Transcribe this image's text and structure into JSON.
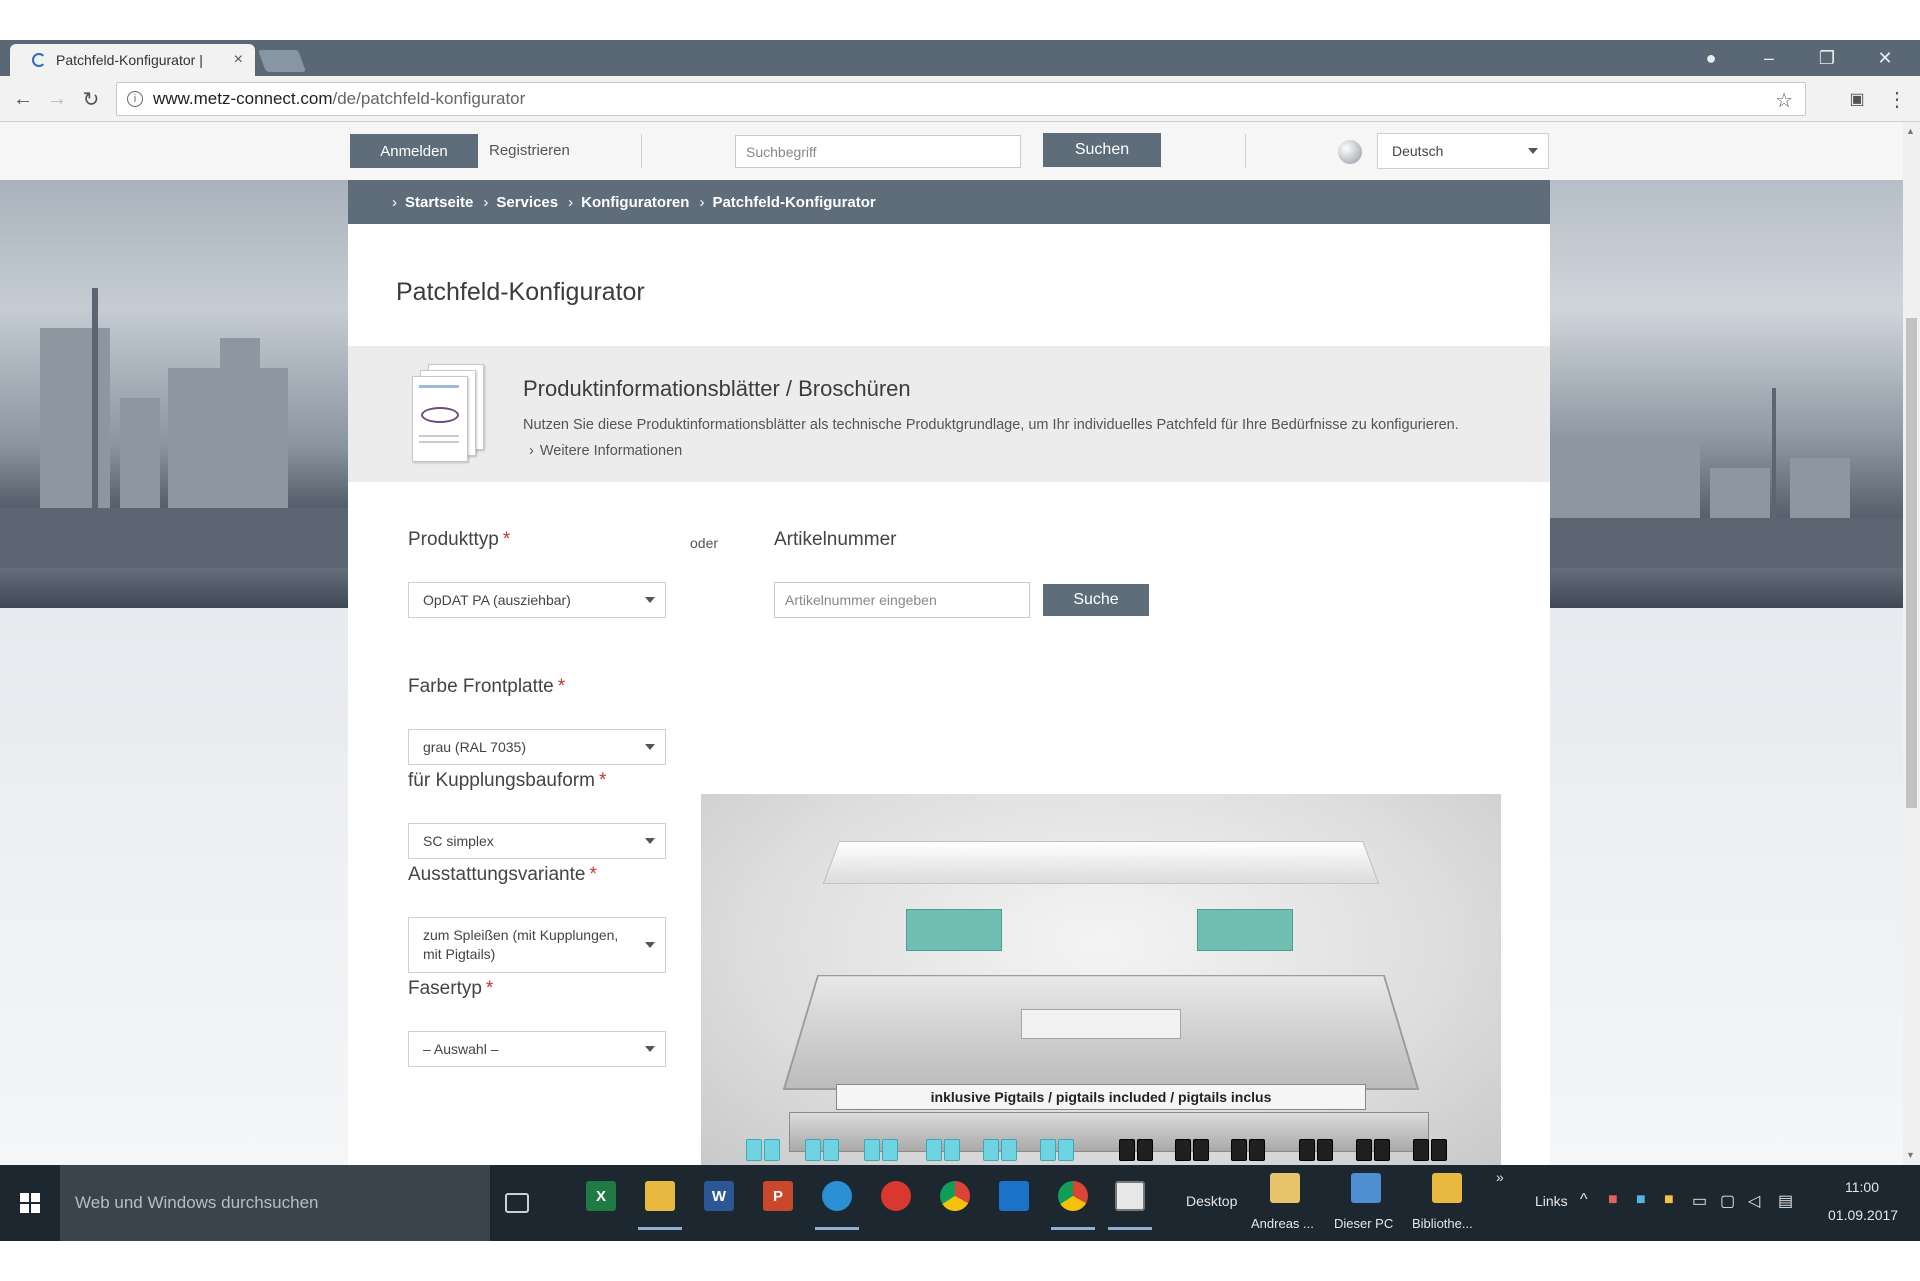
{
  "browser": {
    "tab_title": "Patchfeld-Konfigurator |",
    "tab_close": "×",
    "url_domain": "www.metz-connect.com",
    "url_path": "/de/patchfeld-konfigurator",
    "icons": [
      "back-arrow-icon",
      "forward-arrow-icon",
      "reload-icon",
      "info-icon",
      "star-icon",
      "extension-icon",
      "menu-icon",
      "profile-icon",
      "minimize-icon",
      "restore-icon",
      "close-icon"
    ]
  },
  "utility": {
    "login": "Anmelden",
    "register": "Registrieren",
    "search_placeholder": "Suchbegriff",
    "search_button": "Suchen",
    "language": "Deutsch"
  },
  "breadcrumb": [
    "Startseite",
    "Services",
    "Konfiguratoren",
    "Patchfeld-Konfigurator"
  ],
  "page": {
    "title": "Patchfeld-Konfigurator",
    "info_title": "Produktinformationsblätter / Broschüren",
    "info_text": "Nutzen Sie diese Produktinformationsblätter als technische Produktgrundlage, um Ihr individuelles Patchfeld für Ihre Bedürfnisse zu konfigurieren.",
    "info_link": "Weitere Informationen"
  },
  "form": {
    "required_mark": "*",
    "produkttyp_label": "Produkttyp",
    "produkttyp_value": "OpDAT PA (ausziehbar)",
    "oder": "oder",
    "artikel_label": "Artikelnummer",
    "artikel_placeholder": "Artikelnummer eingeben",
    "artikel_button": "Suche",
    "farbe_label": "Farbe Frontplatte",
    "farbe_value": "grau (RAL 7035)",
    "kupplung_label": "für Kupplungsbauform",
    "kupplung_value": "SC simplex",
    "ausstattung_label": "Ausstattungsvariante",
    "ausstattung_value": "zum Spleißen (mit Kupplungen, mit Pigtails)",
    "fasertyp_label": "Fasertyp",
    "fasertyp_value": "– Auswahl –"
  },
  "product_image": {
    "banner": "inklusive Pigtails / pigtails included / pigtails inclus"
  },
  "taskbar": {
    "search": "Web und Windows durchsuchen",
    "desktop": "Desktop",
    "user": "Andreas ...",
    "pc": "Dieser PC",
    "library": "Bibliothe...",
    "links": "Links",
    "chevron": "»",
    "time": "11:00",
    "date": "01.09.2017"
  }
}
